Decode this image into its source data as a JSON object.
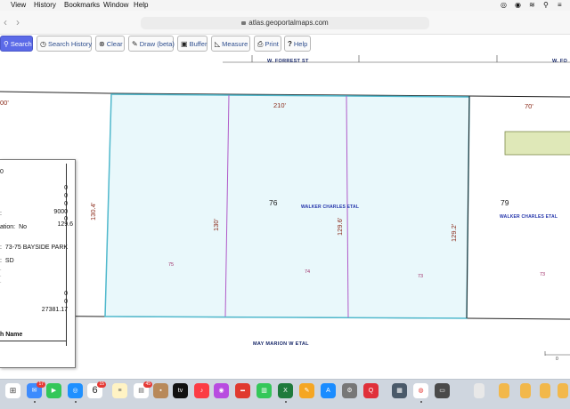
{
  "menubar": {
    "items": [
      "View",
      "History",
      "Bookmarks",
      "Window",
      "Help"
    ]
  },
  "browser": {
    "url": "atlas.geoportalmaps.com",
    "back": "‹",
    "forward": "›"
  },
  "toolbar": {
    "search": "Search",
    "search_history": "Search History",
    "clear": "Clear",
    "draw": "Draw (beta)",
    "buffer": "Buffer",
    "measure": "Measure",
    "print": "Print",
    "help": "Help"
  },
  "map": {
    "street_top_1": "W. FORREST ST",
    "street_top_2": "W. FO",
    "street_bottom": "MAY MARION W ETAL",
    "owner_1": "WALKER CHARLES ETAL",
    "owner_2": "WALKER CHARLES ETAL",
    "dim_210": "210'",
    "dim_70": "70'",
    "dim_left_top": "00'",
    "dim_130_4": "130.4'",
    "dim_130": "130'",
    "dim_129_6": "129.6'",
    "dim_129_2": "129.2'",
    "lot_76": "76",
    "lot_79": "79",
    "sub_75": "75",
    "sub_74": "74",
    "sub_73a": "73",
    "sub_73b": "73",
    "scale": "0"
  },
  "panel": {
    "row_top": "0",
    "v1": "0",
    "v2": "0",
    "v3": "0",
    "v4": "9000",
    "label_colon": ":",
    "v5": "0",
    "v6": "129.6",
    "action_label": "ation:",
    "action_value": "No",
    "address_label": ":",
    "address_value": "73-75 BAYSIDE PARK",
    "zone_label": ":",
    "zone_value": "SD",
    "v7": "0",
    "v8": "0",
    "v9": "27381.17",
    "name_label": "h Name"
  },
  "dock": {
    "mail_badge": "17",
    "calendar_day": "6",
    "calendar_badge": "15",
    "notes_badge": "45"
  }
}
